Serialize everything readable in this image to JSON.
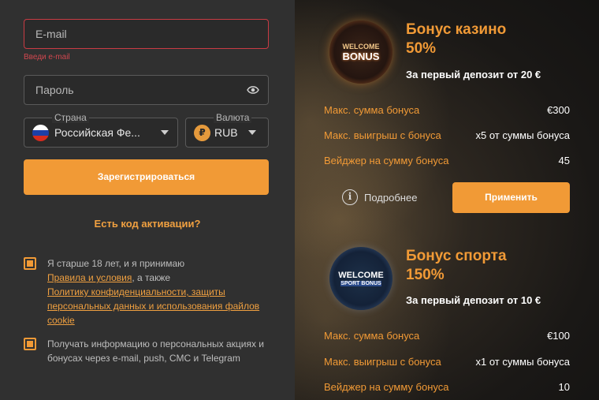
{
  "form": {
    "email_placeholder": "E-mail",
    "email_error": "Введи e-mail",
    "password_placeholder": "Пароль",
    "country_label": "Страна",
    "country_value": "Российская Фе...",
    "currency_label": "Валюта",
    "currency_symbol": "₽",
    "currency_value": "RUB",
    "register_label": "Зарегистрироваться",
    "activation_label": "Есть код активации?",
    "terms_text_1": "Я старше 18 лет, и я принимаю",
    "terms_link_1": "Правила и условия",
    "terms_text_2": ", а также",
    "terms_link_2": "Политику конфиденциальности, защиты персональных данных и использования файлов cookie",
    "news_text": "Получать информацию о персональных акциях и бонусах через e-mail, push, СМС и Telegram"
  },
  "bonuses": {
    "casino": {
      "badge_line1": "WELCOME",
      "badge_line2": "BONUS",
      "title_line1": "Бонус казино",
      "title_line2": "50%",
      "subtitle": "За первый депозит от 20 €",
      "rows": [
        {
          "key": "Макс. сумма бонуса",
          "value": "€300"
        },
        {
          "key": "Макс. выигрыш с бонуса",
          "value": "x5 от суммы бонуса"
        },
        {
          "key": "Вейджер на сумму бонуса",
          "value": "45"
        }
      ],
      "more_label": "Подробнее",
      "apply_label": "Применить"
    },
    "sport": {
      "badge_line1": "WELCOME",
      "badge_line2": "SPORT BONUS",
      "title_line1": "Бонус спорта",
      "title_line2": "150%",
      "subtitle": "За первый депозит от 10 €",
      "rows": [
        {
          "key": "Макс. сумма бонуса",
          "value": "€100"
        },
        {
          "key": "Макс. выигрыш с бонуса",
          "value": "x1 от суммы бонуса"
        },
        {
          "key": "Вейджер на сумму бонуса",
          "value": "10"
        }
      ]
    }
  },
  "colors": {
    "accent": "#f19a36",
    "error": "#c93b44"
  }
}
